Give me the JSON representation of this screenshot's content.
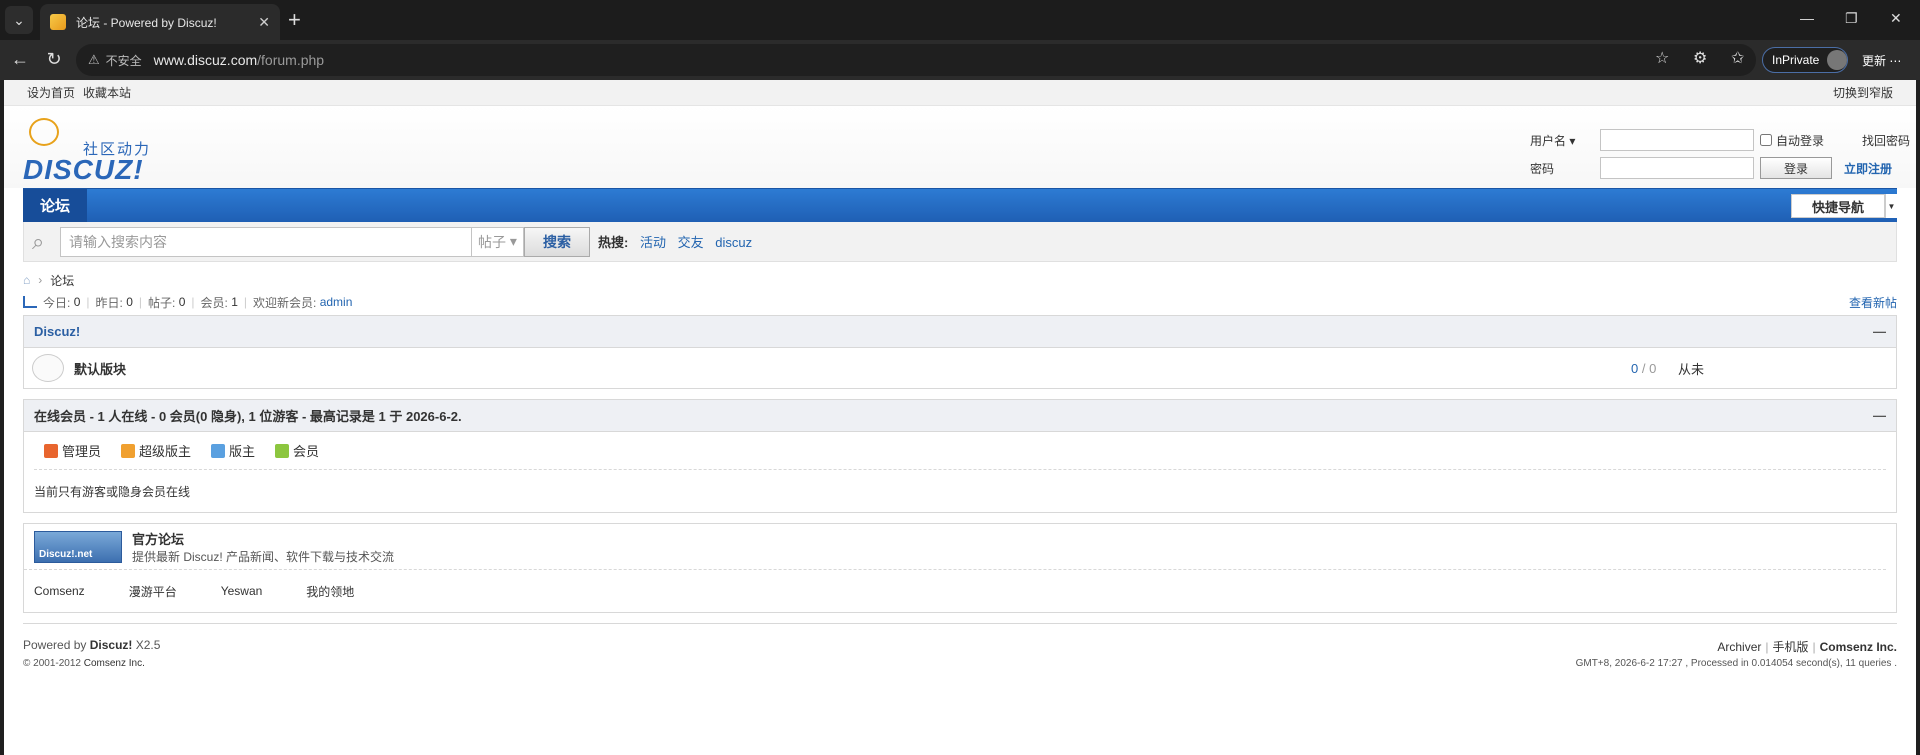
{
  "browser": {
    "tab_title": "论坛 - Powered by Discuz!",
    "insecure_label": "不安全",
    "url_host": "www.discuz.com",
    "url_path": "/forum.php",
    "inprivate_label": "InPrivate",
    "update_label": "更新"
  },
  "topbar": {
    "set_home": "设为首页",
    "bookmark": "收藏本站",
    "switch_width": "切换到窄版"
  },
  "logo": {
    "slogan": "社区动力",
    "word": "DISCUZ!"
  },
  "login": {
    "username_label": "用户名",
    "password_label": "密码",
    "auto_login": "自动登录",
    "forgot": "找回密码",
    "login_btn": "登录",
    "register": "立即注册"
  },
  "nav": {
    "active": "论坛",
    "quick_nav": "快捷导航"
  },
  "search": {
    "placeholder": "请输入搜索内容",
    "type": "帖子",
    "button": "搜索",
    "hot_label": "热搜:",
    "hot_items": [
      "活动",
      "交友",
      "discuz"
    ]
  },
  "breadcrumb": {
    "current": "论坛"
  },
  "stats": {
    "today_label": "今日:",
    "today": "0",
    "yesterday_label": "昨日:",
    "yesterday": "0",
    "posts_label": "帖子:",
    "posts": "0",
    "members_label": "会员:",
    "members": "1",
    "welcome_label": "欢迎新会员:",
    "newest": "admin",
    "view_new": "查看新帖"
  },
  "category": {
    "title": "Discuz!",
    "collapse": "—",
    "forum_name": "默认版块",
    "threads": "0",
    "sep": "/",
    "posts": "0",
    "last_post": "从未"
  },
  "online": {
    "title": "在线会员 - 1 人在线 - 0 会员(0 隐身), 1 位游客 - 最高记录是 1 于 2026-6-2.",
    "collapse": "—",
    "legend": [
      {
        "label": "管理员",
        "color": "#e8652e"
      },
      {
        "label": "超级版主",
        "color": "#f0a030"
      },
      {
        "label": "版主",
        "color": "#5aa0e0"
      },
      {
        "label": "会员",
        "color": "#8cc63f"
      }
    ],
    "note": "当前只有游客或隐身会员在线"
  },
  "links": {
    "logo_text": "Discuz!.net",
    "title": "官方论坛",
    "desc": "提供最新 Discuz! 产品新闻、软件下载与技术交流",
    "text_links": [
      "Comsenz",
      "漫游平台",
      "Yeswan",
      "我的领地"
    ]
  },
  "footer": {
    "powered_prefix": "Powered by",
    "powered_brand": "Discuz!",
    "version": "X2.5",
    "copyright_prefix": "© 2001-2012",
    "copyright_company": "Comsenz Inc.",
    "archiver": "Archiver",
    "mobile": "手机版",
    "company": "Comsenz Inc.",
    "timing": "GMT+8, 2026-6-2 17:27 , Processed in 0.014054 second(s), 11 queries ."
  }
}
